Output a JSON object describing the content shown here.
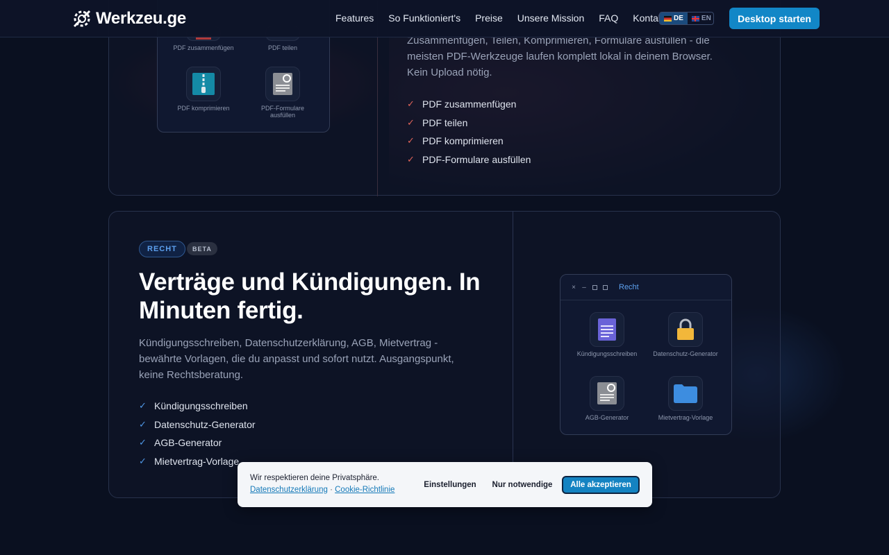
{
  "header": {
    "logo_text": "Werkzeu.ge",
    "nav": [
      "Features",
      "So Funktioniert's",
      "Preise",
      "Unsere Mission",
      "FAQ",
      "Kontakt"
    ],
    "lang_de": "DE",
    "lang_en": "EN",
    "cta": "Desktop starten"
  },
  "pdf_section": {
    "tools": [
      {
        "label": "PDF zusammenfügen",
        "icon": "merge-icon"
      },
      {
        "label": "PDF teilen",
        "icon": "split-icon"
      },
      {
        "label": "PDF komprimieren",
        "icon": "zip-icon"
      },
      {
        "label": "PDF-Formulare ausfüllen",
        "icon": "form-icon"
      }
    ],
    "description": "Zusammenfügen, Teilen, Komprimieren, Formulare ausfüllen - die meisten PDF-Werkzeuge laufen komplett lokal in deinem Browser. Kein Upload nötig.",
    "features": [
      "PDF zusammenfügen",
      "PDF teilen",
      "PDF komprimieren",
      "PDF-Formulare ausfüllen"
    ]
  },
  "legal_section": {
    "badge": "RECHT",
    "beta": "BETA",
    "heading": "Verträge und Kündigungen. In Minuten fertig.",
    "description": "Kündigungsschreiben, Datenschutzerklärung, AGB, Mietvertrag - bewährte Vorlagen, die du anpasst und sofort nutzt. Ausgangspunkt, keine Rechtsberatung.",
    "features": [
      "Kündigungsschreiben",
      "Datenschutz-Generator",
      "AGB-Generator",
      "Mietvertrag-Vorlage"
    ],
    "window_title": "Recht",
    "tools": [
      {
        "label": "Kündigungsschreiben",
        "icon": "document-icon"
      },
      {
        "label": "Datenschutz-Generator",
        "icon": "lock-icon"
      },
      {
        "label": "AGB-Generator",
        "icon": "form-icon"
      },
      {
        "label": "Mietvertrag-Vorlage",
        "icon": "folder-icon"
      }
    ]
  },
  "cookie": {
    "message": "Wir respektieren deine Privatsphäre.",
    "link_privacy": "Datenschutzerklärung",
    "separator": "·",
    "link_cookie": "Cookie-Richtlinie",
    "settings": "Einstellungen",
    "necessary": "Nur notwendige",
    "accept": "Alle akzeptieren"
  },
  "colors": {
    "accent": "#1287c7",
    "check_red": "#e0645a",
    "check_blue": "#4f97e6"
  }
}
